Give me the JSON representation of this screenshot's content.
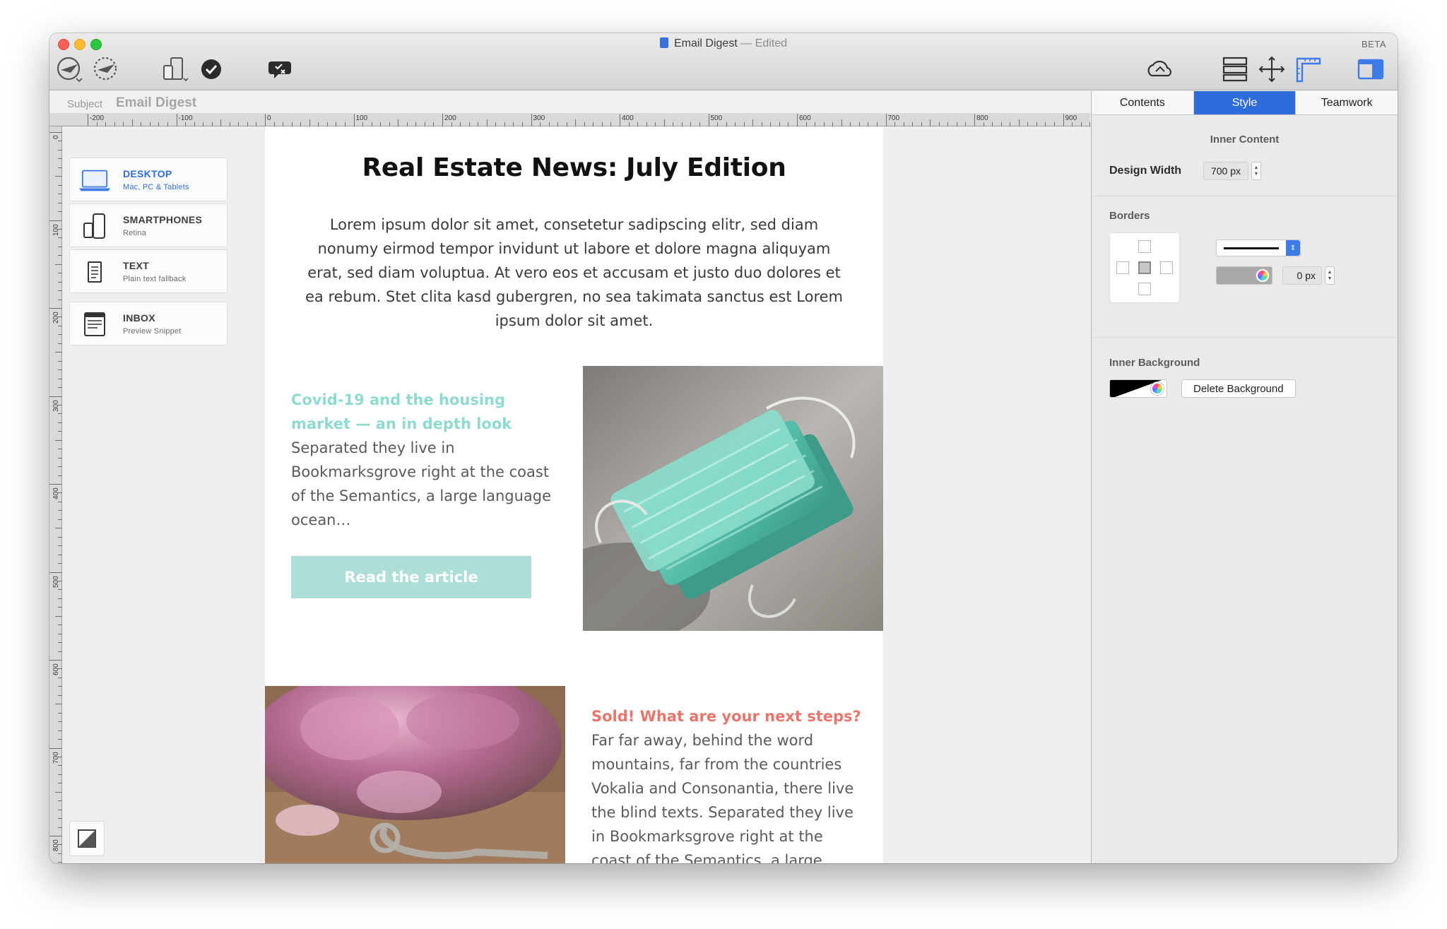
{
  "window": {
    "title": "Email Digest",
    "status": "— Edited",
    "badge": "BETA"
  },
  "toolbar": {
    "left_icons": [
      "send-test-icon",
      "schedule-send-icon",
      "device-preview-icon",
      "check-icon",
      "spam-test-icon"
    ],
    "right_icons": [
      "cloud-sync-icon",
      "layout-blocks-icon",
      "move-icon",
      "ruler-icon",
      "sidebar-toggle-icon"
    ]
  },
  "subject": {
    "label": "Subject",
    "value": "Email Digest"
  },
  "rulers": {
    "horizontal": [
      "-200",
      "-100",
      "0",
      "100",
      "200",
      "300",
      "400",
      "500",
      "600",
      "700",
      "800",
      "900"
    ],
    "vertical": [
      "0",
      "100",
      "200",
      "300",
      "400",
      "500",
      "600",
      "700",
      "800"
    ]
  },
  "devices": [
    {
      "title": "DESKTOP",
      "subtitle": "Mac, PC & Tablets",
      "icon": "laptop-icon",
      "active": true
    },
    {
      "title": "SMARTPHONES",
      "subtitle": "Retina",
      "icon": "phone-tablet-icon",
      "active": false
    },
    {
      "title": "TEXT",
      "subtitle": "Plain text fallback",
      "icon": "text-document-icon",
      "active": false
    },
    {
      "title": "INBOX",
      "subtitle": "Preview Snippet",
      "icon": "inbox-icon",
      "active": false
    }
  ],
  "email": {
    "title": "Real Estate News: July Edition",
    "intro": "Lorem ipsum dolor sit amet, consetetur sadipscing elitr, sed diam nonumy eirmod tempor invidunt ut labore et dolore magna aliquyam erat, sed diam voluptua. At vero eos et accusam et justo duo dolores et ea rebum. Stet clita kasd gubergren, no sea takimata sanctus est Lorem ipsum dolor sit amet.",
    "article1": {
      "heading": "Covid-19 and the housing market — an in depth look",
      "body": "Separated they live in Bookmarksgrove right at the coast of the Semantics, a large language ocean…",
      "button": "Read the article"
    },
    "article2": {
      "heading": "Sold! What are your next steps?",
      "body": "Far far away, behind the word mountains, far from the countries Vokalia and Consonantia, there live the blind texts. Separated they live in Bookmarksgrove right at the coast of the Semantics, a large language ocean."
    },
    "colors": {
      "teal": "#8fdad0",
      "coral": "#e8766c",
      "button": "#addfd8"
    }
  },
  "inspector": {
    "tabs": [
      "Contents",
      "Style",
      "Teamwork"
    ],
    "active_tab": "Style",
    "inner_content": {
      "heading": "Inner Content",
      "design_width_label": "Design Width",
      "design_width_value": "700 px"
    },
    "borders": {
      "heading": "Borders",
      "width_value": "0 px"
    },
    "inner_background": {
      "heading": "Inner Background",
      "delete_label": "Delete Background"
    },
    "accent": "#2d6ddb"
  }
}
